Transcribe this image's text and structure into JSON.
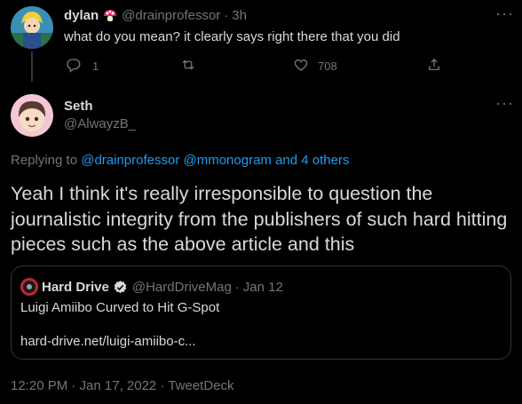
{
  "parent_tweet": {
    "display_name": "dylan",
    "handle": "@drainprofessor",
    "separator": "·",
    "time": "3h",
    "text": "what do you mean? it clearly says right there that you did",
    "reply_count": "1",
    "like_count": "708"
  },
  "main_tweet": {
    "display_name": "Seth",
    "handle": "@AlwayzB_",
    "replying_prefix": "Replying to",
    "replying_targets": "@drainprofessor @mmonogram and 4 others",
    "text": "Yeah I think it's really irresponsible to question the journalistic integrity from the publishers of such hard hitting pieces such as the above article and this",
    "footer": "12:20 PM · Jan 17, 2022 · TweetDeck"
  },
  "quoted_tweet": {
    "display_name": "Hard Drive",
    "handle": "@HardDriveMag",
    "separator": "·",
    "time": "Jan 12",
    "text": "Luigi Amiibo Curved to Hit G-Spot",
    "link": "hard-drive.net/luigi-amiibo-c..."
  },
  "icons": [
    "mushroom-icon",
    "more-icon",
    "reply-icon",
    "retweet-icon",
    "like-icon",
    "share-icon",
    "verified-badge-icon"
  ],
  "colors": {
    "background": "#000000",
    "text": "#d9d9d9",
    "muted": "#6e767d",
    "link": "#1d9bf0",
    "border": "#2f3336"
  }
}
